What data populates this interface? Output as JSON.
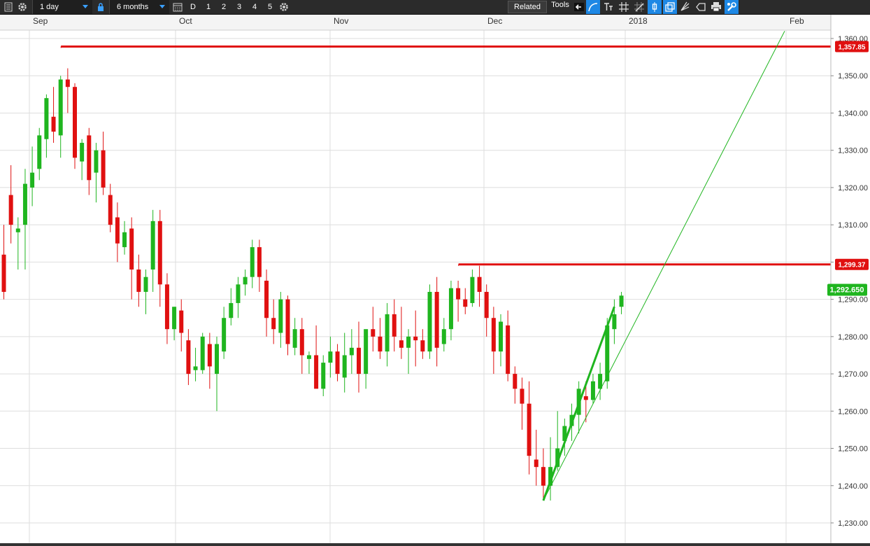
{
  "toolbar": {
    "interval": "1 day",
    "range": "6 months",
    "period_buttons": [
      "D",
      "1",
      "2",
      "3",
      "4",
      "5"
    ],
    "related_label": "Related",
    "tools_label": "Tools",
    "tools": [
      "back-arrow-icon",
      "curve-line-icon",
      "text-tool-icon",
      "grid-lines-icon",
      "crosshair-grid-icon",
      "candlestick-icon",
      "duplicate-icon",
      "fork-tool-icon",
      "tag-shape-icon",
      "print-icon",
      "settings-wrench-icon"
    ]
  },
  "chart": {
    "months": [
      {
        "label": "Sep",
        "date": "2017-09-01"
      },
      {
        "label": "Oct",
        "date": "2017-10-02"
      },
      {
        "label": "Nov",
        "date": "2017-11-01"
      },
      {
        "label": "Dec",
        "date": "2017-12-01"
      },
      {
        "label": "2018",
        "date": "2018-01-02"
      },
      {
        "label": "Feb",
        "date": "2018-02-01"
      }
    ],
    "y_ticks": [
      "1,230.00",
      "1,240.00",
      "1,250.00",
      "1,260.00",
      "1,270.00",
      "1,280.00",
      "1,290.00",
      "1,300.00",
      "1,310.00",
      "1,320.00",
      "1,330.00",
      "1,340.00",
      "1,350.00",
      "1,360.00"
    ],
    "resistance_1": "1,357.85",
    "resistance_2": "1,299.37",
    "last_price": "1,292.650",
    "colors": {
      "up": "#1fb51f",
      "down": "#e01010",
      "level": "#e01010",
      "trend": "#1fb51f",
      "grid": "#dedede",
      "last": "#1fb51f"
    }
  },
  "chart_data": {
    "type": "candlestick",
    "ylim": [
      1226,
      1362
    ],
    "candles": [
      [
        1302,
        1310,
        1290,
        1292
      ],
      [
        1318,
        1326,
        1305,
        1310
      ],
      [
        1308,
        1312,
        1298,
        1309
      ],
      [
        1310,
        1325,
        1298,
        1321
      ],
      [
        1320,
        1331,
        1315,
        1324
      ],
      [
        1325,
        1336,
        1322,
        1334
      ],
      [
        1333,
        1345,
        1328,
        1344
      ],
      [
        1339,
        1347,
        1332,
        1335
      ],
      [
        1334,
        1350,
        1328,
        1349
      ],
      [
        1349,
        1352,
        1340,
        1347
      ],
      [
        1347,
        1348,
        1325,
        1328
      ],
      [
        1327,
        1333,
        1322,
        1332
      ],
      [
        1334,
        1336,
        1318,
        1322
      ],
      [
        1324,
        1332,
        1316,
        1330
      ],
      [
        1330,
        1335,
        1318,
        1320
      ],
      [
        1318,
        1321,
        1308,
        1310
      ],
      [
        1312,
        1316,
        1300,
        1305
      ],
      [
        1304,
        1311,
        1302,
        1308
      ],
      [
        1309,
        1312,
        1290,
        1298
      ],
      [
        1298,
        1302,
        1288,
        1292
      ],
      [
        1292,
        1298,
        1286,
        1296
      ],
      [
        1298,
        1314,
        1292,
        1311
      ],
      [
        1311,
        1314,
        1288,
        1294
      ],
      [
        1294,
        1297,
        1278,
        1282
      ],
      [
        1282,
        1288,
        1279,
        1288
      ],
      [
        1287,
        1290,
        1276,
        1281
      ],
      [
        1279,
        1282,
        1267,
        1270
      ],
      [
        1271,
        1277,
        1268,
        1272
      ],
      [
        1271,
        1281,
        1270,
        1280
      ],
      [
        1278,
        1281,
        1266,
        1272
      ],
      [
        1270,
        1280,
        1260,
        1278
      ],
      [
        1276,
        1288,
        1274,
        1285
      ],
      [
        1285,
        1293,
        1283,
        1289
      ],
      [
        1289,
        1296,
        1285,
        1294
      ],
      [
        1294,
        1298,
        1291,
        1296
      ],
      [
        1296,
        1306,
        1293,
        1304
      ],
      [
        1304,
        1306,
        1292,
        1296
      ],
      [
        1295,
        1298,
        1280,
        1285
      ],
      [
        1285,
        1290,
        1278,
        1282
      ],
      [
        1281,
        1292,
        1277,
        1290
      ],
      [
        1290,
        1291,
        1275,
        1278
      ],
      [
        1277,
        1285,
        1275,
        1282
      ],
      [
        1282,
        1285,
        1270,
        1275
      ],
      [
        1274,
        1276,
        1270,
        1275
      ],
      [
        1275,
        1283,
        1268,
        1266
      ],
      [
        1266,
        1275,
        1264,
        1273
      ],
      [
        1273,
        1280,
        1269,
        1276
      ],
      [
        1276,
        1278,
        1268,
        1270
      ],
      [
        1269,
        1281,
        1265,
        1275
      ],
      [
        1275,
        1282,
        1270,
        1277
      ],
      [
        1277,
        1284,
        1265,
        1270
      ],
      [
        1270,
        1281,
        1266,
        1282
      ],
      [
        1282,
        1288,
        1276,
        1280
      ],
      [
        1280,
        1285,
        1274,
        1276
      ],
      [
        1276,
        1289,
        1272,
        1286
      ],
      [
        1286,
        1290,
        1276,
        1280
      ],
      [
        1279,
        1288,
        1274,
        1277
      ],
      [
        1277,
        1282,
        1270,
        1280
      ],
      [
        1280,
        1287,
        1272,
        1279
      ],
      [
        1279,
        1282,
        1274,
        1276
      ],
      [
        1276,
        1294,
        1274,
        1292
      ],
      [
        1292,
        1296,
        1272,
        1277
      ],
      [
        1278,
        1285,
        1276,
        1282
      ],
      [
        1282,
        1295,
        1279,
        1293
      ],
      [
        1293,
        1295,
        1284,
        1290
      ],
      [
        1290,
        1293,
        1286,
        1288
      ],
      [
        1289,
        1298,
        1288,
        1296
      ],
      [
        1296,
        1299,
        1288,
        1292
      ],
      [
        1292,
        1294,
        1280,
        1285
      ],
      [
        1285,
        1288,
        1270,
        1276
      ],
      [
        1276,
        1286,
        1272,
        1284
      ],
      [
        1283,
        1287,
        1268,
        1270
      ],
      [
        1270,
        1272,
        1262,
        1266
      ],
      [
        1266,
        1269,
        1255,
        1262
      ],
      [
        1262,
        1268,
        1243,
        1248
      ],
      [
        1247,
        1255,
        1240,
        1245
      ],
      [
        1245,
        1250,
        1236,
        1240
      ],
      [
        1240,
        1253,
        1236,
        1245
      ],
      [
        1245,
        1260,
        1244,
        1250
      ],
      [
        1252,
        1258,
        1248,
        1256
      ],
      [
        1256,
        1262,
        1252,
        1259
      ],
      [
        1259,
        1268,
        1254,
        1266
      ],
      [
        1264,
        1268,
        1257,
        1263
      ],
      [
        1263,
        1270,
        1262,
        1268
      ],
      [
        1266,
        1273,
        1263,
        1270
      ],
      [
        1268,
        1285,
        1266,
        1283
      ],
      [
        1282,
        1290,
        1278,
        1286
      ],
      [
        1288,
        1292,
        1286,
        1291
      ]
    ],
    "horizontal_levels": [
      {
        "value": 1357.85,
        "from_index": 8
      },
      {
        "value": 1299.37,
        "from_index": 64
      }
    ],
    "trendlines": [
      {
        "from": [
          76,
          1236
        ],
        "to": [
          86,
          1288
        ],
        "width": 3
      },
      {
        "from": [
          76,
          1236
        ],
        "to": [
          110,
          1362
        ],
        "width": 1
      }
    ],
    "last_price": 1292.65,
    "grid": true
  }
}
